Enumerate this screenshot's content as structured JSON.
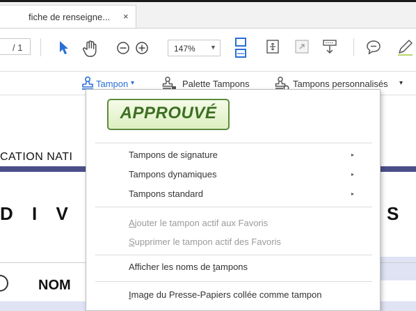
{
  "tab": {
    "title": "fiche de renseigne...",
    "close": "×"
  },
  "toolbar": {
    "page_count": "/ 1",
    "zoom": "147%"
  },
  "stamp_toolbar": {
    "tampon_label": "Tampon",
    "tampon_caret": "▾",
    "palette_label": "Palette Tampons",
    "perso_label": "Tampons personnalisés",
    "perso_caret": "▾"
  },
  "document": {
    "heading1": "CATION NATI",
    "heading2": "D I V I",
    "heading3": "S",
    "nom": "NOM"
  },
  "menu": {
    "stamp_preview": "APPROUVÉ",
    "submenus": [
      {
        "label": "Tampons de signature",
        "arrow": "▸"
      },
      {
        "label": "Tampons dynamiques",
        "arrow": "▸"
      },
      {
        "label": "Tampons standard",
        "arrow": "▸"
      }
    ],
    "add_fav_prefix": "A",
    "add_fav_rest": "jouter le tampon actif aux Favoris",
    "remove_fav_prefix": "S",
    "remove_fav_rest": "upprimer le tampon actif des Favoris",
    "show_names_pre": "Afficher les noms de ",
    "show_names_key": "t",
    "show_names_post": "ampons",
    "clipboard_prefix": "I",
    "clipboard_rest": "mage du Presse-Papiers collée comme tampon"
  },
  "colors": {
    "accent": "#2a6fd6",
    "stamp_green": "#3d6f22"
  },
  "icons": [
    "select-arrow-icon",
    "hand-icon",
    "zoom-out-icon",
    "zoom-in-icon",
    "fit-width-icon",
    "fit-page-icon",
    "fullscreen-icon",
    "scroll-mode-icon",
    "comment-icon",
    "pen-icon",
    "stamp-icon"
  ]
}
